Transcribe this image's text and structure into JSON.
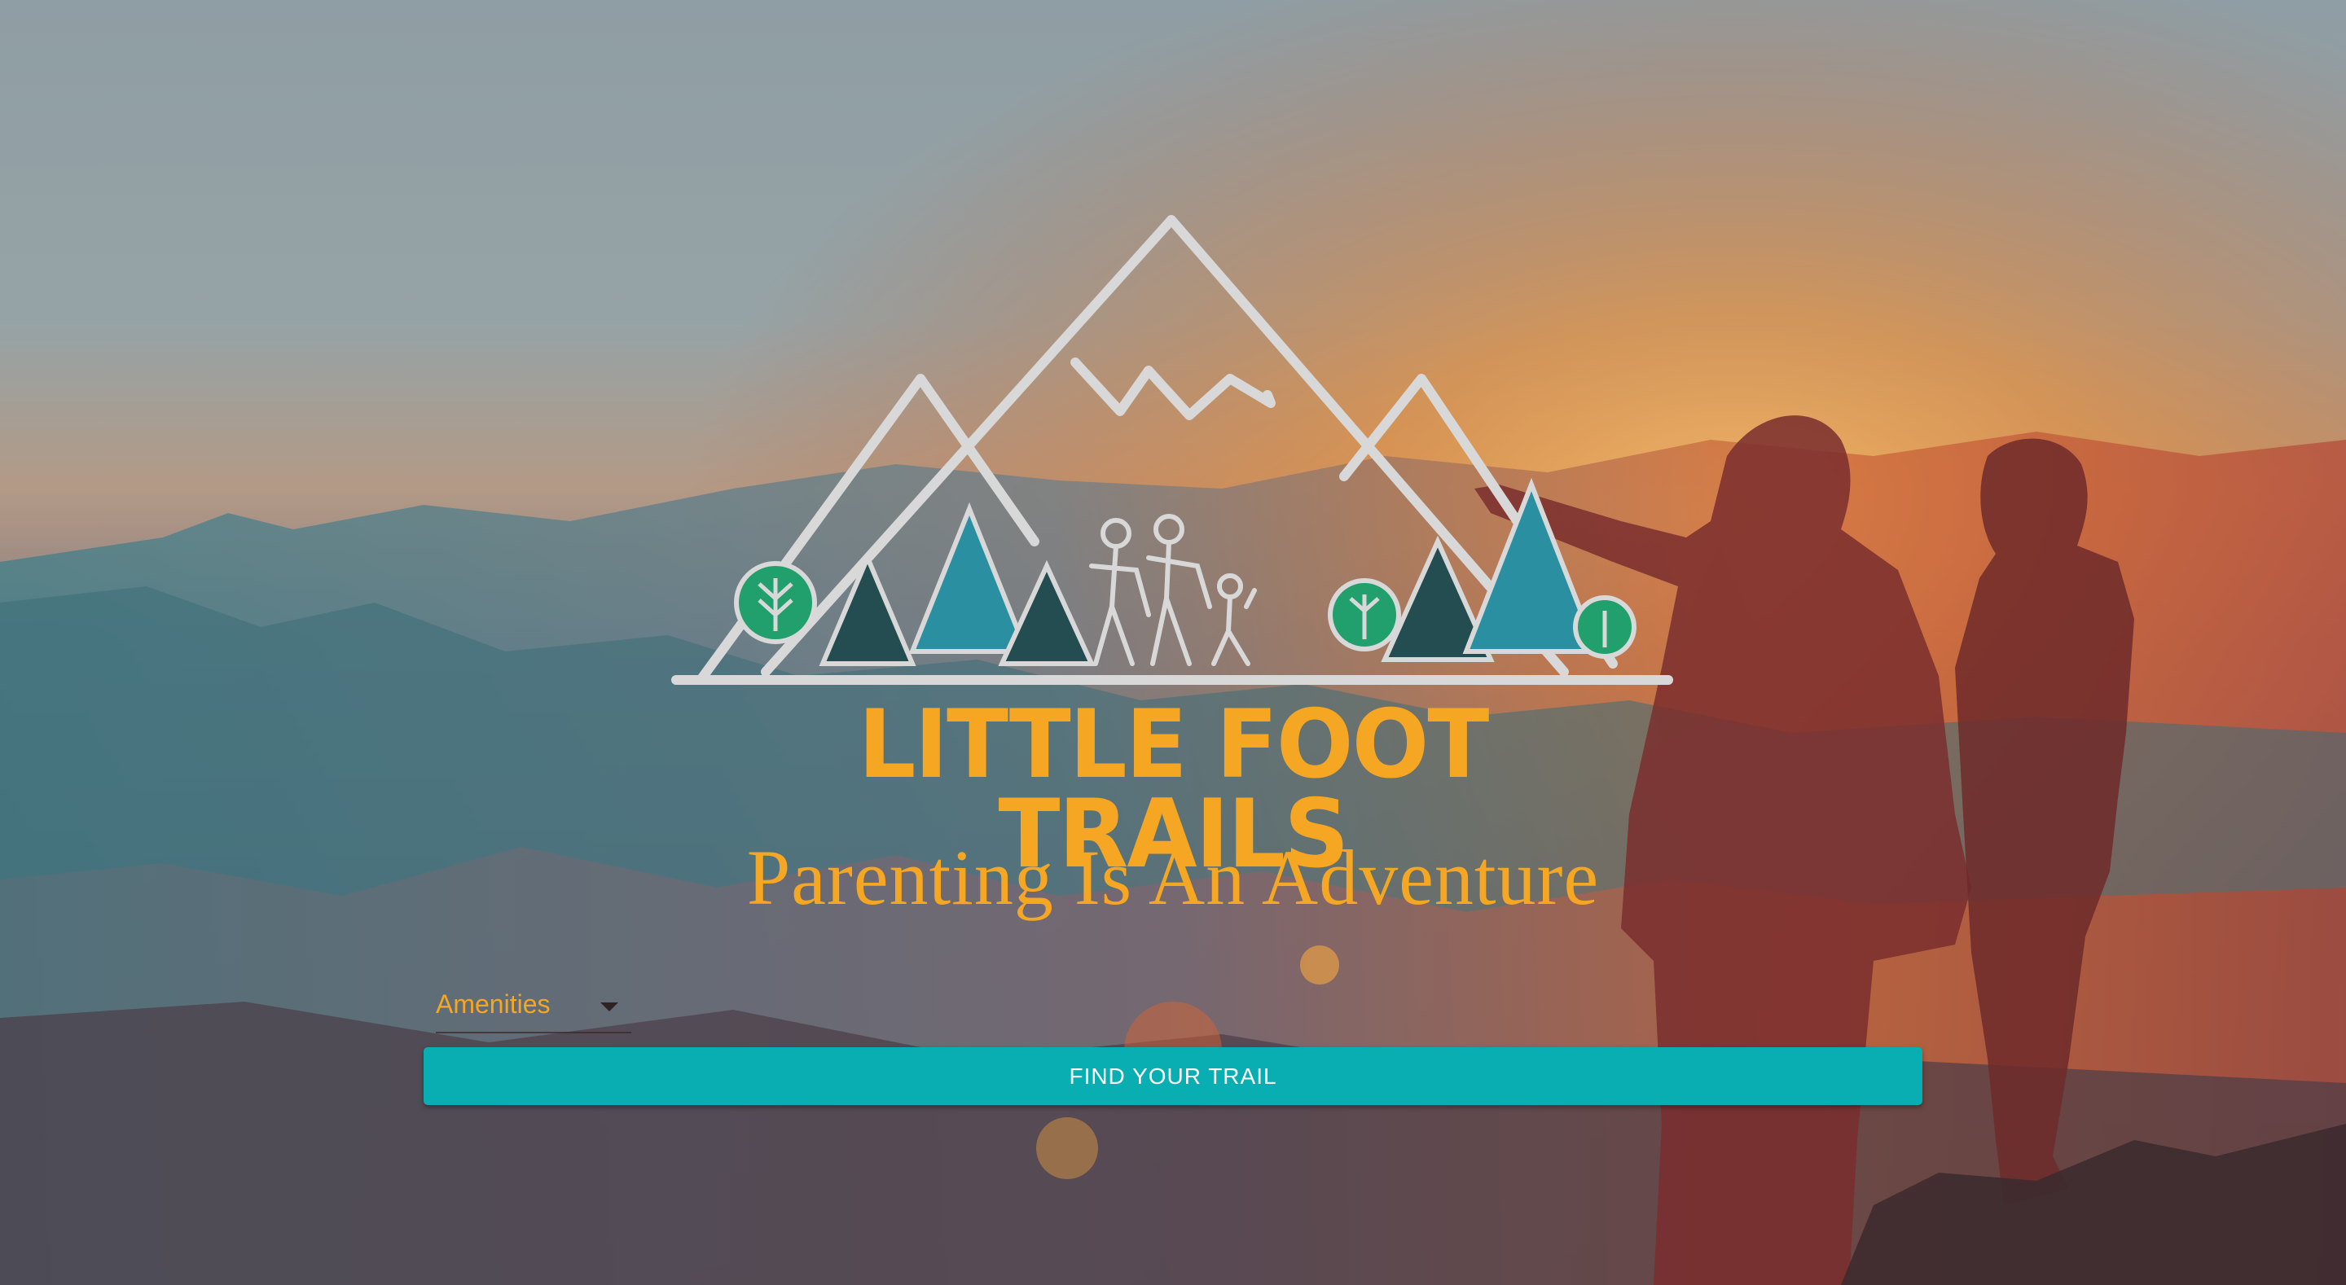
{
  "brand": {
    "logo_text": "LITTLE FOOT TRAILS",
    "tagline": "Parenting Is An Adventure",
    "logo_color": "#f5a623"
  },
  "search": {
    "amenities_label": "Amenities",
    "find_button_label": "FIND YOUR TRAIL",
    "button_color": "#08aeb2"
  },
  "icons": {
    "amenities_caret": "chevron-down-icon"
  }
}
